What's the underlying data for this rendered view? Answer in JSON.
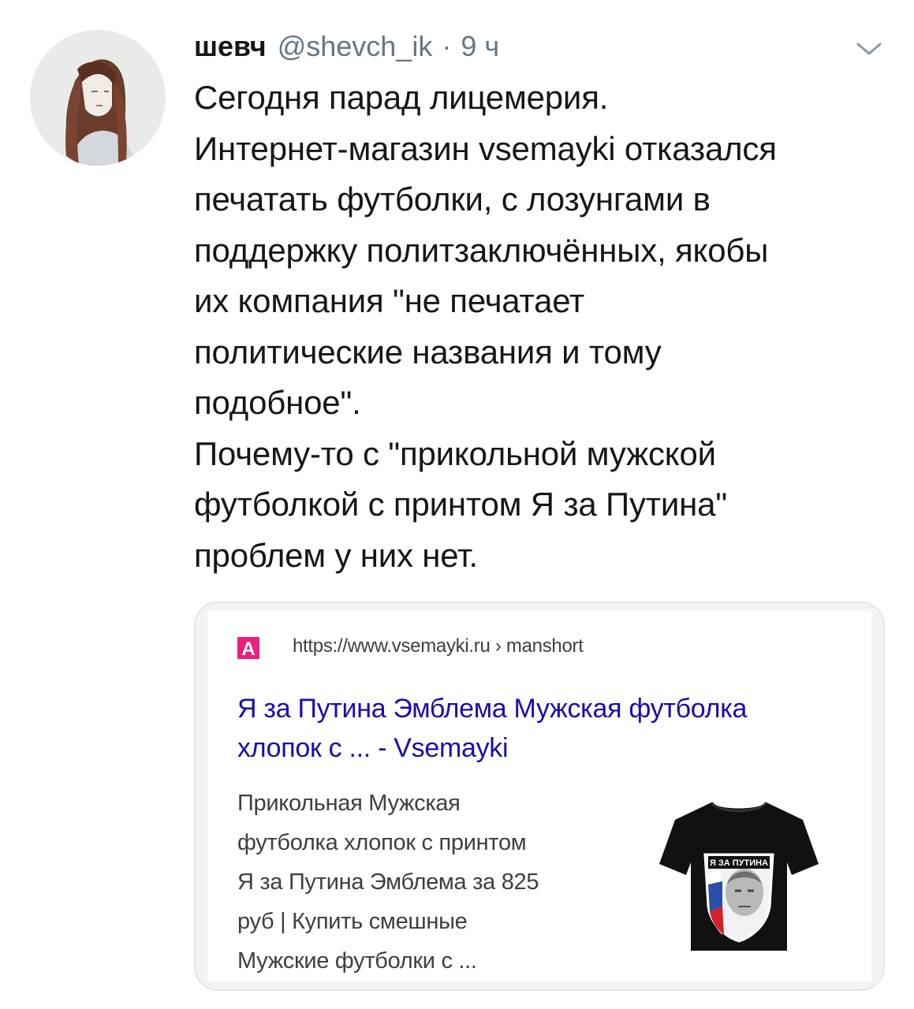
{
  "tweet": {
    "author_name": "шевч",
    "handle": "@shevch_ik",
    "separator": "·",
    "time": "9 ч",
    "text_lines": [
      "Сегодня парад лицемерия.",
      "Интернет-магазин vsemayki отказался",
      "печатать футболки, с лозунгами в",
      "поддержку политзаключённых, якобы",
      "их компания \"не печатает",
      "политические названия и тому",
      "подобное\".",
      "Почему-то с \"прикольной мужской",
      "футболкой с принтом Я за Путина\"",
      "проблем у них нет."
    ],
    "menu_icon": "chevron-down-icon"
  },
  "card": {
    "favicon_letter": "A",
    "url": "https://www.vsemayki.ru › manshort",
    "title_lines": [
      "Я за Путина Эмблема Мужская футболка",
      "хлопок с ... - Vsemayki"
    ],
    "snippet_lines": [
      "Прикольная Мужская",
      "футболка хлопок с принтом",
      "Я за Путина Эмблема за 825",
      "руб | Купить смешные",
      "Мужские футболки с ..."
    ],
    "tshirt_print_text": "Я ЗА ПУТИНА"
  },
  "colors": {
    "text": "#14171a",
    "secondary": "#657786",
    "link": "#1a0dab",
    "favicon": "#e9207d",
    "border": "#e1e8ed"
  }
}
